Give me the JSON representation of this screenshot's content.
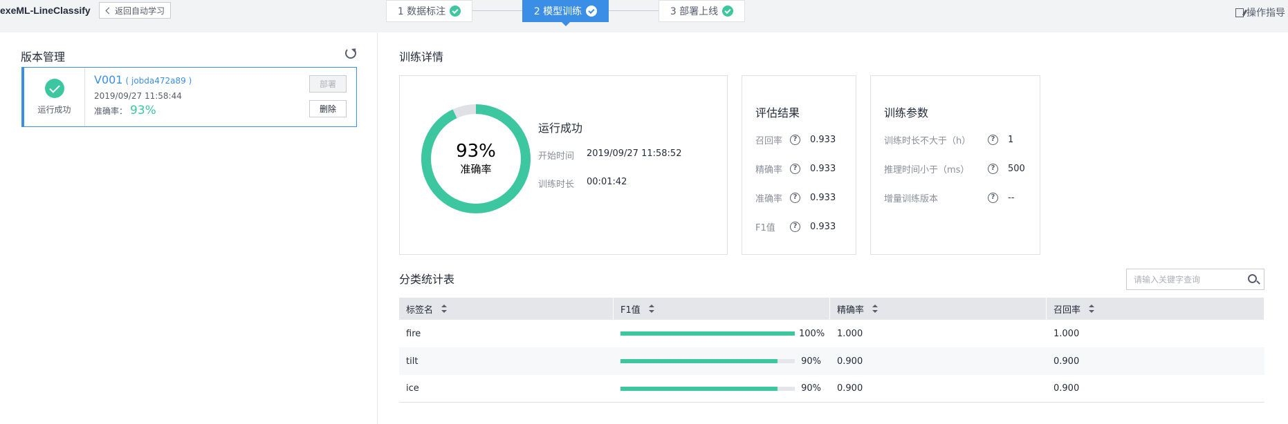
{
  "app": {
    "title": "exeML-LineClassify",
    "back_label": "返回自动学习",
    "guide_label": "操作指导"
  },
  "steps": [
    {
      "label": "1 数据标注"
    },
    {
      "label": "2 模型训练"
    },
    {
      "label": "3 部署上线"
    }
  ],
  "version_panel": {
    "title": "版本管理",
    "card": {
      "status": "运行成功",
      "version": "V001",
      "job": "( jobda472a89 )",
      "time": "2019/09/27 11:58:44",
      "acc_label": "准确率：",
      "acc_value": "93%",
      "deploy_label": "部署",
      "delete_label": "删除"
    }
  },
  "train_detail": {
    "title": "训练详情",
    "accuracy_fraction": 0.93,
    "donut_pct": "93%",
    "donut_label": "准确率",
    "status": "运行成功",
    "start_label": "开始时间",
    "start_value": "2019/09/27 11:58:52",
    "duration_label": "训练时长",
    "duration_value": "00:01:42",
    "colors": {
      "accent": "#3cc7a0",
      "remain": "#dfe1e6",
      "primary": "#3a8ee6"
    }
  },
  "eval": {
    "title": "评估结果",
    "rows": [
      {
        "label": "召回率",
        "value": "0.933"
      },
      {
        "label": "精确率",
        "value": "0.933"
      },
      {
        "label": "准确率",
        "value": "0.933"
      },
      {
        "label": "F1值",
        "value": "0.933"
      }
    ]
  },
  "params": {
    "title": "训练参数",
    "rows": [
      {
        "label": "训练时长不大于（h）",
        "value": "1"
      },
      {
        "label": "推理时间小于（ms）",
        "value": "500"
      },
      {
        "label": "增量训练版本",
        "value": "--"
      }
    ]
  },
  "cls_table": {
    "title": "分类统计表",
    "search_placeholder": "请输入关键字查询",
    "headers": [
      "标签名",
      "F1值",
      "精确率",
      "召回率"
    ],
    "rows": [
      {
        "name": "fire",
        "f1": 1.0,
        "f1_pct": "100%",
        "precision": "1.000",
        "recall": "1.000"
      },
      {
        "name": "tilt",
        "f1": 0.9,
        "f1_pct": "90%",
        "precision": "0.900",
        "recall": "0.900"
      },
      {
        "name": "ice",
        "f1": 0.9,
        "f1_pct": "90%",
        "precision": "0.900",
        "recall": "0.900"
      }
    ]
  }
}
